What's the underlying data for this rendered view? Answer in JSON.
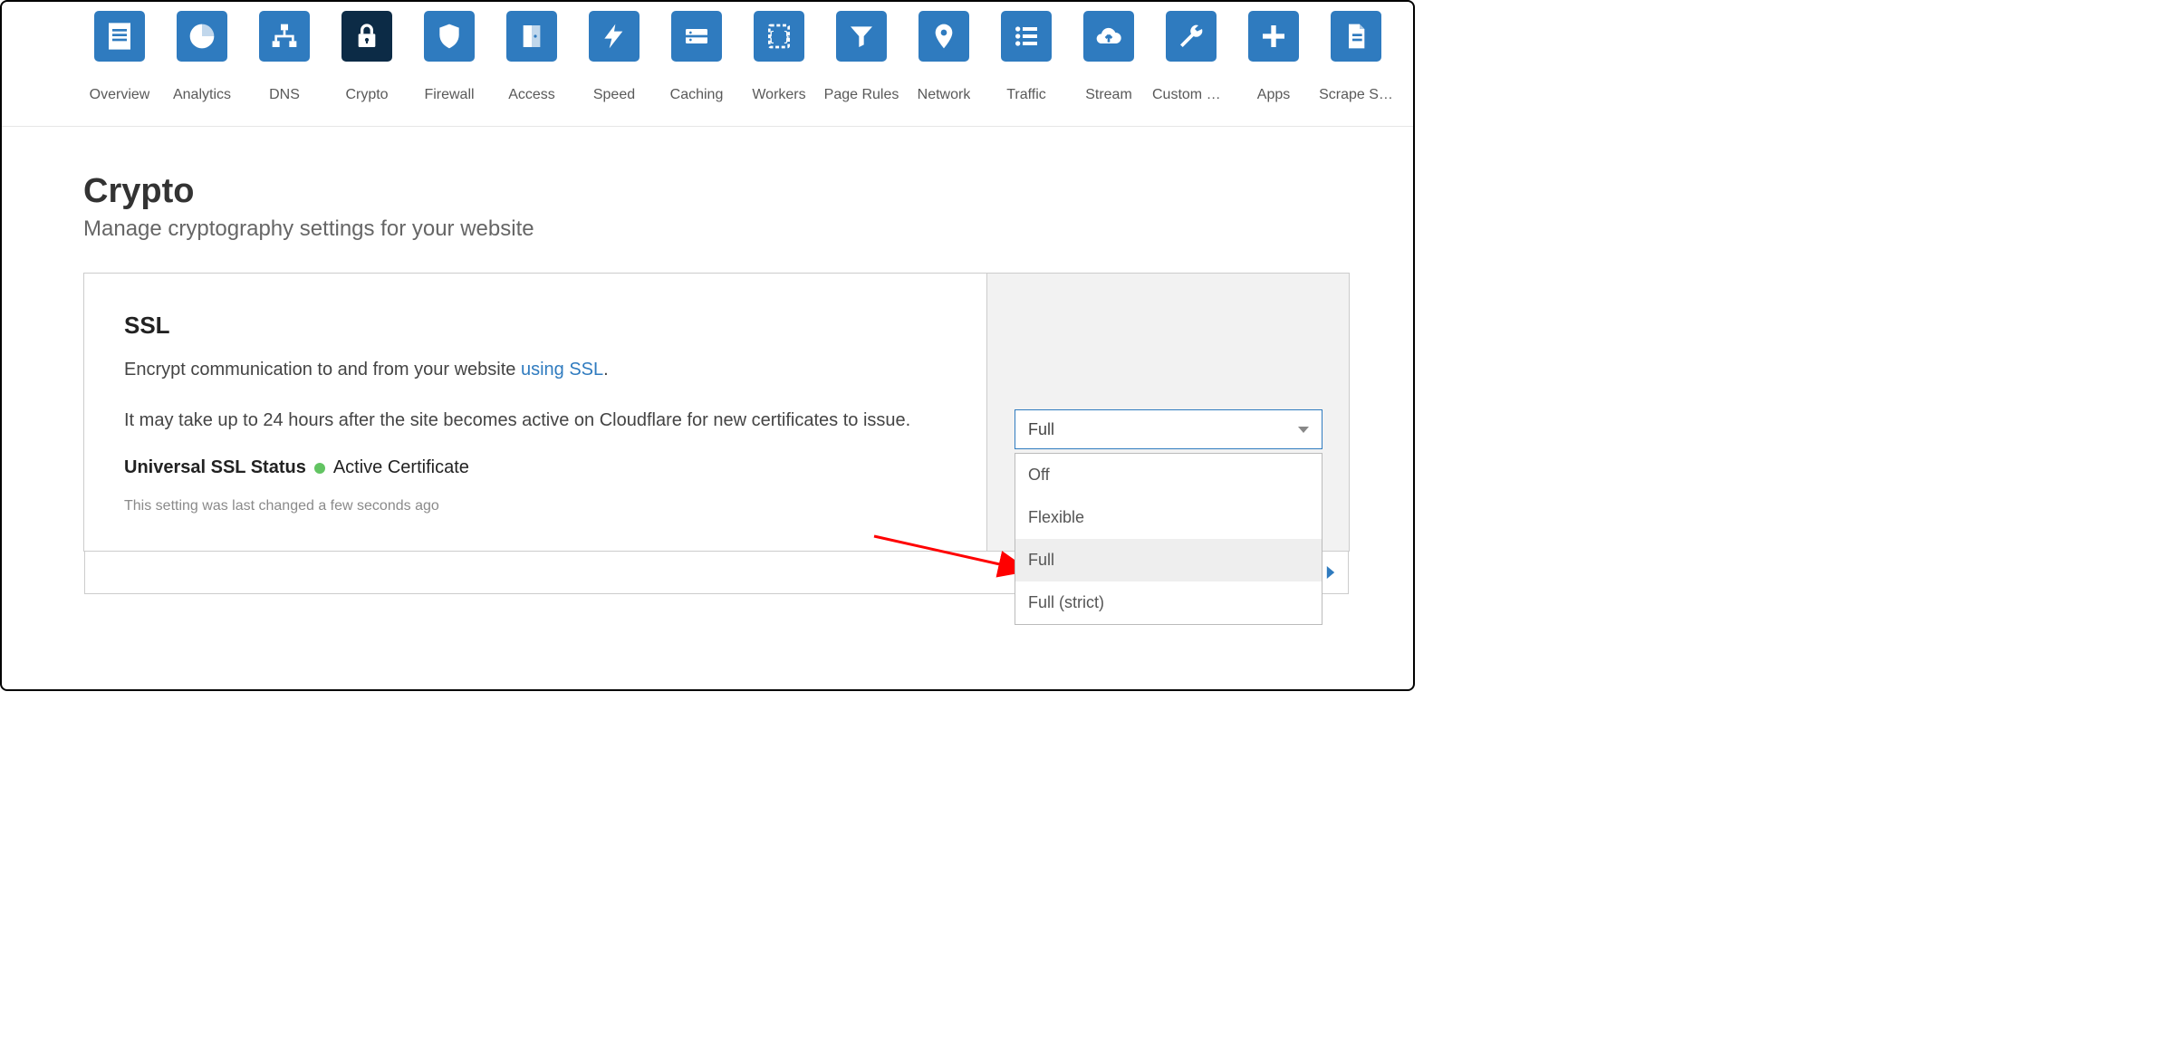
{
  "nav": {
    "items": [
      {
        "label": "Overview",
        "icon": "clipboard"
      },
      {
        "label": "Analytics",
        "icon": "pie"
      },
      {
        "label": "DNS",
        "icon": "sitemap"
      },
      {
        "label": "Crypto",
        "icon": "lock",
        "active": true
      },
      {
        "label": "Firewall",
        "icon": "shield"
      },
      {
        "label": "Access",
        "icon": "door"
      },
      {
        "label": "Speed",
        "icon": "bolt"
      },
      {
        "label": "Caching",
        "icon": "drive"
      },
      {
        "label": "Workers",
        "icon": "braces"
      },
      {
        "label": "Page Rules",
        "icon": "funnel"
      },
      {
        "label": "Network",
        "icon": "marker"
      },
      {
        "label": "Traffic",
        "icon": "list"
      },
      {
        "label": "Stream",
        "icon": "cloud"
      },
      {
        "label": "Custom P…",
        "icon": "wrench"
      },
      {
        "label": "Apps",
        "icon": "plus"
      },
      {
        "label": "Scrape S…",
        "icon": "file"
      }
    ]
  },
  "page": {
    "title": "Crypto",
    "subtitle": "Manage cryptography settings for your website"
  },
  "ssl_card": {
    "title": "SSL",
    "desc_prefix": "Encrypt communication to and from your website ",
    "desc_link": "using SSL",
    "desc_suffix": ".",
    "note": "It may take up to 24 hours after the site becomes active on Cloudflare for new certificates to issue.",
    "status_label": "Universal SSL Status",
    "status_value": "Active Certificate",
    "status_color": "#62c462",
    "meta": "This setting was last changed a few seconds ago",
    "select": {
      "value": "Full",
      "options": [
        "Off",
        "Flexible",
        "Full",
        "Full (strict)"
      ]
    }
  }
}
